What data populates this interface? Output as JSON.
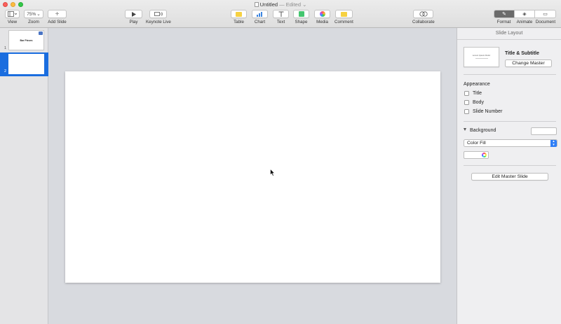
{
  "window": {
    "title": "Untitled",
    "status": "— Edited"
  },
  "toolbar": {
    "view_label": "View",
    "zoom_value": "75%",
    "zoom_label": "Zoom",
    "add_slide_label": "Add Slide",
    "play_label": "Play",
    "keynote_live_label": "Keynote Live",
    "table_label": "Table",
    "chart_label": "Chart",
    "text_label": "Text",
    "shape_label": "Shape",
    "media_label": "Media",
    "comment_label": "Comment",
    "collaborate_label": "Collaborate",
    "format_label": "Format",
    "animate_label": "Animate",
    "document_label": "Document"
  },
  "navigator": {
    "slides": [
      {
        "number": "1",
        "title": "Bar Pieces",
        "selected": false
      },
      {
        "number": "2",
        "title": "",
        "selected": true
      }
    ]
  },
  "inspector": {
    "header": "Slide Layout",
    "master_name": "Title & Subtitle",
    "master_thumb_text": "Lorem Ipsum Dolor",
    "change_master_label": "Change Master",
    "appearance_label": "Appearance",
    "checkboxes": [
      {
        "label": "Title",
        "checked": false
      },
      {
        "label": "Body",
        "checked": false
      },
      {
        "label": "Slide Number",
        "checked": false
      }
    ],
    "background_label": "Background",
    "fill_type": "Color Fill",
    "edit_master_label": "Edit Master Slide"
  },
  "colors": {
    "accent": "#1a6ddf",
    "table_icon": "#f6d142",
    "chart_icon": "#3c85e0",
    "shape_icon": "#44c66f",
    "comment_icon": "#f6d142"
  }
}
